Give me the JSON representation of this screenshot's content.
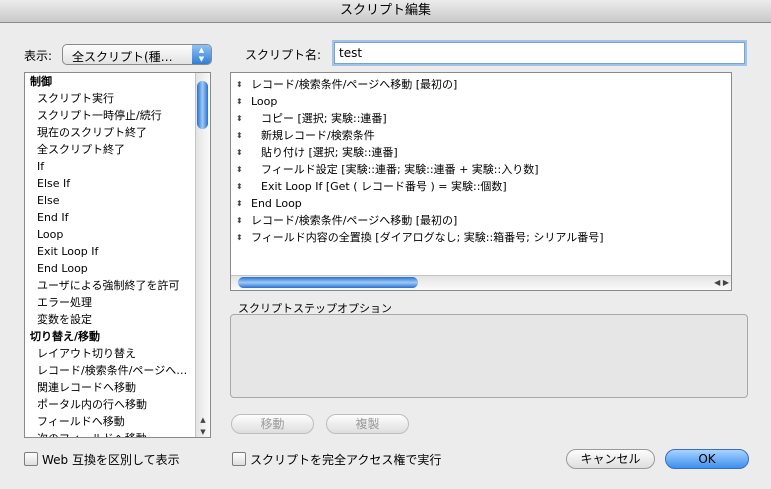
{
  "window": {
    "title": "スクリプト編集"
  },
  "view": {
    "label": "表示:",
    "selected": "全スクリプト(種…"
  },
  "script_name": {
    "label": "スクリプト名:",
    "value": "test"
  },
  "steps": [
    {
      "label": "制御",
      "header": true
    },
    {
      "label": "スクリプト実行"
    },
    {
      "label": "スクリプト一時停止/続行"
    },
    {
      "label": "現在のスクリプト終了"
    },
    {
      "label": "全スクリプト終了"
    },
    {
      "label": "If"
    },
    {
      "label": "Else If"
    },
    {
      "label": "Else"
    },
    {
      "label": "End If"
    },
    {
      "label": "Loop"
    },
    {
      "label": "Exit Loop If"
    },
    {
      "label": "End Loop"
    },
    {
      "label": "ユーザによる強制終了を許可"
    },
    {
      "label": "エラー処理"
    },
    {
      "label": "変数を設定"
    },
    {
      "label": "切り替え/移動",
      "header": true
    },
    {
      "label": "レイアウト切り替え"
    },
    {
      "label": "レコード/検索条件/ページへ…"
    },
    {
      "label": "関連レコードへ移動"
    },
    {
      "label": "ポータル内の行へ移動"
    },
    {
      "label": "フィールドへ移動"
    },
    {
      "label": "次のフィールドへ移動"
    }
  ],
  "script_lines": [
    {
      "indent": 0,
      "text": "レコード/検索条件/ページへ移動 [最初の]"
    },
    {
      "indent": 0,
      "text": "Loop"
    },
    {
      "indent": 1,
      "text": "コピー [選択; 実験::連番]"
    },
    {
      "indent": 1,
      "text": "新規レコード/検索条件"
    },
    {
      "indent": 1,
      "text": "貼り付け [選択; 実験::連番]"
    },
    {
      "indent": 1,
      "text": "フィールド設定 [実験::連番; 実験::連番 + 実験::入り数]"
    },
    {
      "indent": 1,
      "text": "Exit Loop If [Get ( レコード番号 ) = 実験::個数]"
    },
    {
      "indent": 0,
      "text": "End Loop"
    },
    {
      "indent": 0,
      "text": "レコード/検索条件/ページへ移動 [最初の]"
    },
    {
      "indent": 0,
      "text": "フィールド内容の全置換 [ダイアログなし; 実験::箱番号; シリアル番号]"
    }
  ],
  "step_options": {
    "label": "スクリプトステップオプション"
  },
  "buttons": {
    "move": "移動",
    "duplicate": "複製",
    "cancel": "キャンセル",
    "ok": "OK"
  },
  "options": {
    "web_compat": "Web 互換を区別して表示",
    "full_access": "スクリプトを完全アクセス権で実行"
  },
  "colors": {
    "accent": "#3d8ff0",
    "scroll_thumb": "#2b6fd0"
  }
}
